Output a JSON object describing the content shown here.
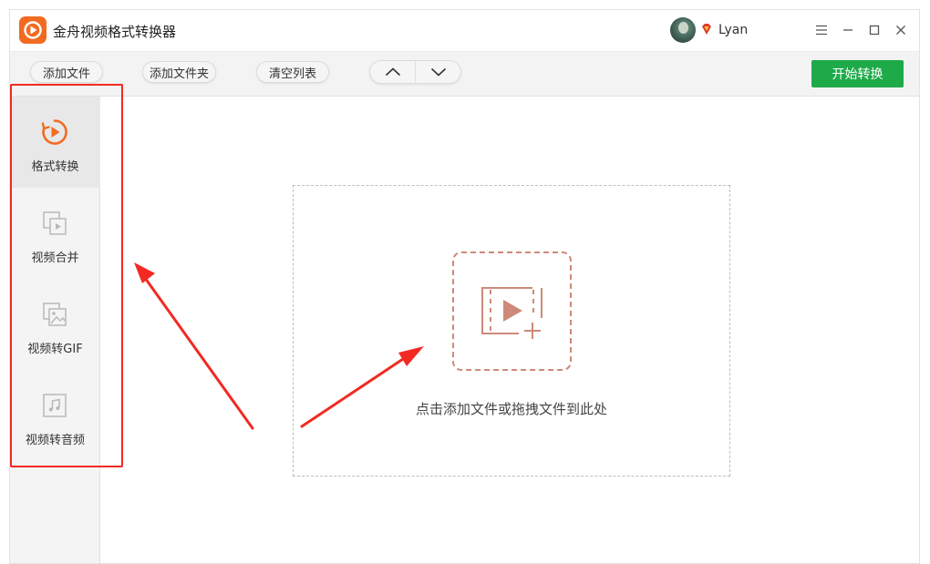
{
  "app": {
    "title": "金舟视频格式转换器",
    "logo_icon": "play-circle-logo-icon",
    "accent": "#f26b21"
  },
  "user": {
    "name": "Lyan",
    "vip_icon": "vip-diamond-icon"
  },
  "window_controls": {
    "menu": "≡",
    "minimize": "—",
    "maximize": "☐",
    "close": "✕"
  },
  "toolbar": {
    "add_file": "添加文件",
    "add_folder": "添加文件夹",
    "clear_list": "清空列表",
    "move_up_icon": "chevron-up-icon",
    "move_down_icon": "chevron-down-icon",
    "start": "开始转换",
    "start_color": "#1faa4a"
  },
  "sidebar": {
    "items": [
      {
        "label": "格式转换",
        "icon": "format-convert-icon",
        "active": true
      },
      {
        "label": "视频合并",
        "icon": "video-merge-icon",
        "active": false
      },
      {
        "label": "视频转GIF",
        "icon": "video-to-gif-icon",
        "active": false
      },
      {
        "label": "视频转音频",
        "icon": "video-to-audio-icon",
        "active": false
      }
    ]
  },
  "main": {
    "drop_text": "点击添加文件或拖拽文件到此处",
    "drop_icon": "add-video-icon"
  },
  "annotations": {
    "color": "#f22a22"
  }
}
